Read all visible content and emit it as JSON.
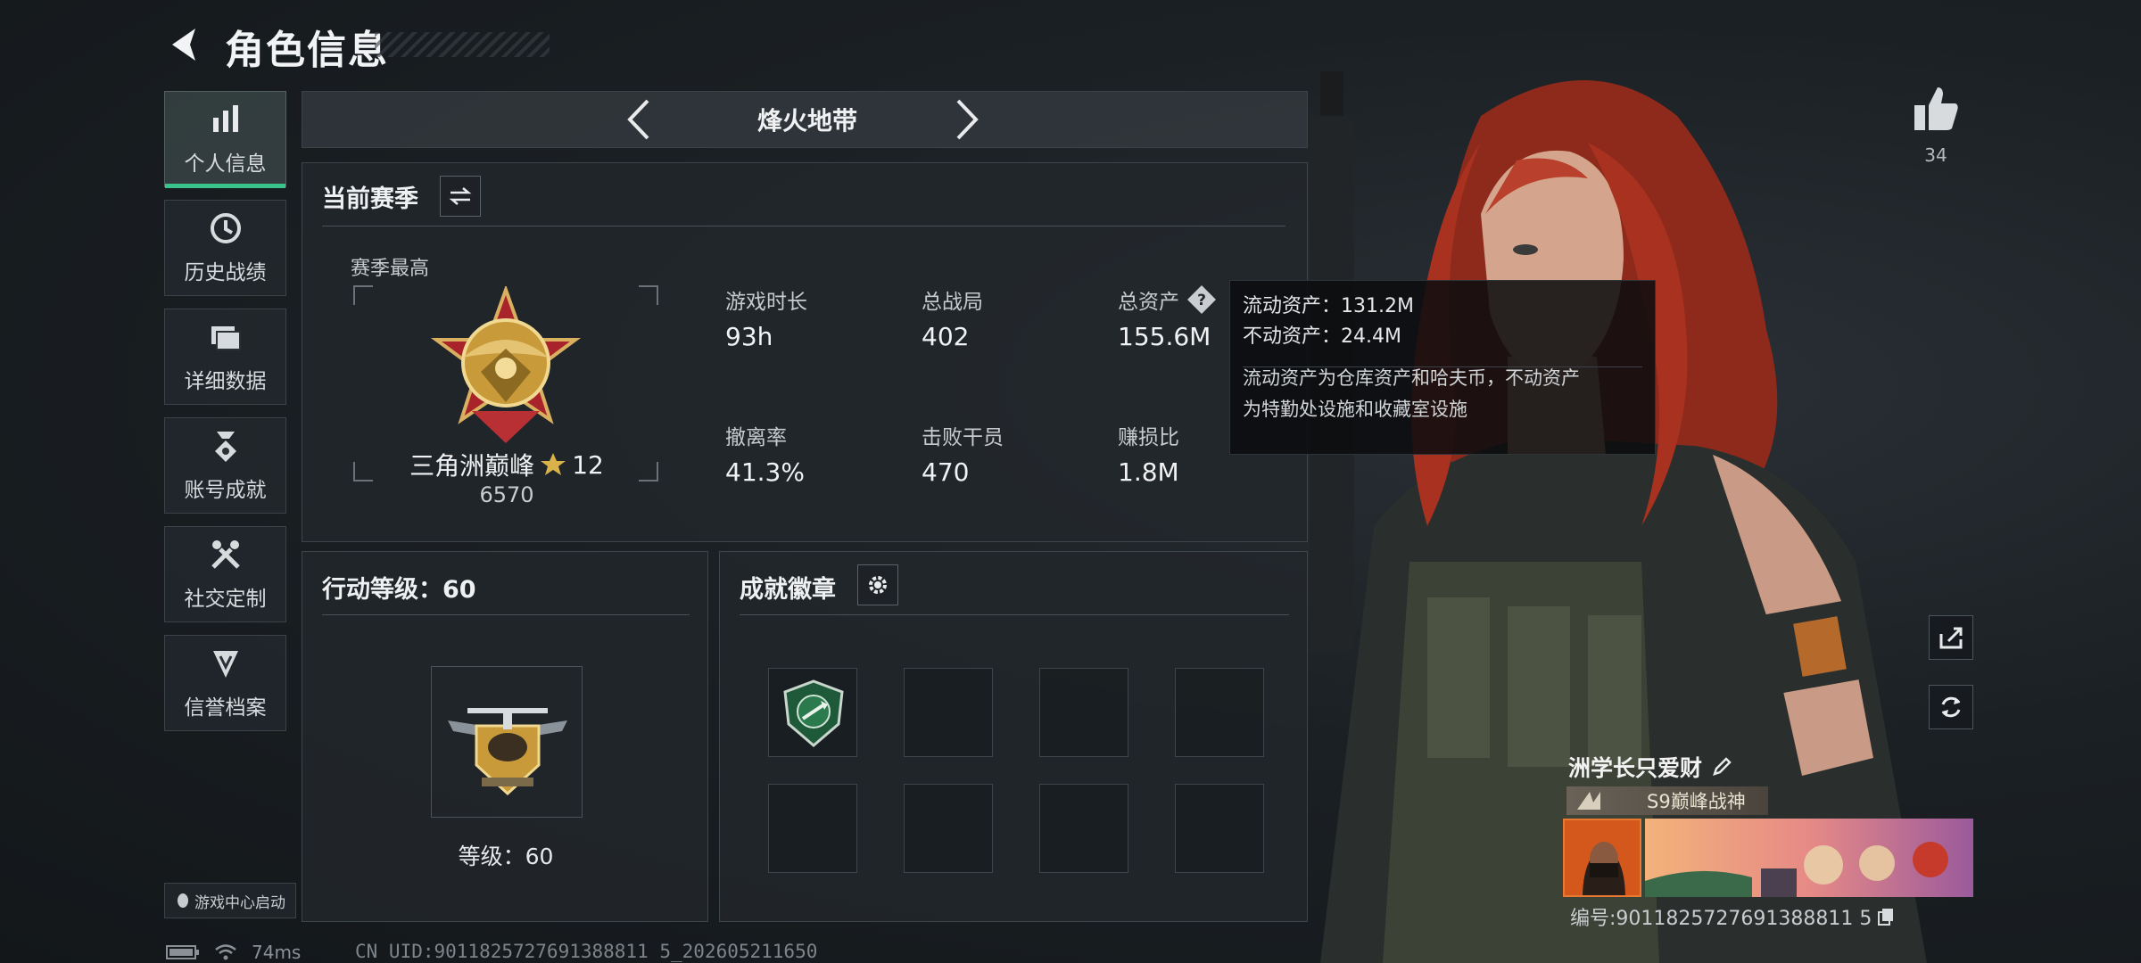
{
  "header": {
    "title": "角色信息"
  },
  "sidebar": {
    "items": [
      {
        "label": "个人信息",
        "icon": "bar-chart-icon",
        "active": true
      },
      {
        "label": "历史战绩",
        "icon": "clock-icon"
      },
      {
        "label": "详细数据",
        "icon": "folder-icon"
      },
      {
        "label": "账号成就",
        "icon": "medal-icon"
      },
      {
        "label": "社交定制",
        "icon": "tools-icon"
      },
      {
        "label": "信誉档案",
        "icon": "shield-icon"
      }
    ],
    "game_center_label": "游戏中心启动"
  },
  "mode": {
    "name": "烽火地带"
  },
  "season": {
    "title": "当前赛季",
    "best_label": "赛季最高",
    "rank_name": "三角洲巅峰",
    "rank_stars": "12",
    "rank_score": "6570",
    "stats": [
      {
        "label": "游戏时长",
        "value": "93h"
      },
      {
        "label": "总战局",
        "value": "402"
      },
      {
        "label": "总资产",
        "value": "155.6M"
      },
      {
        "label": "撤离率",
        "value": "41.3%"
      },
      {
        "label": "击败干员",
        "value": "470"
      },
      {
        "label": "赚损比",
        "value": "1.8M"
      }
    ]
  },
  "tooltip": {
    "liquid": "流动资产：131.2M",
    "fixed": "不动资产：24.4M",
    "desc_1": "流动资产为仓库资产和哈夫币，不动资产",
    "desc_2": "为特勤处设施和收藏室设施"
  },
  "level": {
    "title": "行动等级：60",
    "label": "等级：60"
  },
  "badges": {
    "title": "成就徽章"
  },
  "profile": {
    "likes": "34",
    "name": "洲学长只爱财",
    "title_tag": "S9巅峰战神",
    "player_id": "编号:9011825727691388811 5"
  },
  "status": {
    "ping": "74ms",
    "uid": "CN UID:9011825727691388811 5_202605211650"
  },
  "colors": {
    "accent": "#38c48a",
    "panel": "#22272c",
    "gold": "#c99a3a"
  }
}
